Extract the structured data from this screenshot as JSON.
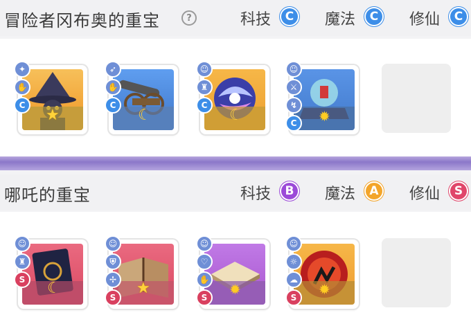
{
  "section1": {
    "title": "冒险者冈布奥的重宝",
    "help_icon": "?",
    "categories": [
      {
        "label": "科技",
        "grade": "C"
      },
      {
        "label": "魔法",
        "grade": "C"
      },
      {
        "label": "修仙",
        "grade": "C"
      }
    ],
    "items": [
      {
        "name": "witch-item",
        "theme": "#f2a63a",
        "bottom": "#b49a3c",
        "badge_grade": "C",
        "rating": "star"
      },
      {
        "name": "cannon-item",
        "theme": "#5c8fe0",
        "bottom": "#5b7db0",
        "badge_grade": "C",
        "rating": "moon"
      },
      {
        "name": "orb-item",
        "theme": "#f0a838",
        "bottom": "#c29a34",
        "badge_grade": "C",
        "rating": "moon"
      },
      {
        "name": "crystal-ball-item",
        "theme": "#4b84d6",
        "bottom": "#486d9e",
        "badge_grade": "C",
        "rating": "sun"
      }
    ]
  },
  "section2": {
    "title": "哪吒的重宝",
    "categories": [
      {
        "label": "科技",
        "grade": "B"
      },
      {
        "label": "魔法",
        "grade": "A"
      },
      {
        "label": "修仙",
        "grade": "S"
      }
    ],
    "items": [
      {
        "name": "dark-book-item",
        "theme": "#e0566e",
        "bottom": "#b24a66",
        "badge_grade": "S",
        "rating": "moon"
      },
      {
        "name": "old-book-item",
        "theme": "#e0566e",
        "bottom": "#c0566a",
        "badge_grade": "S",
        "rating": "star"
      },
      {
        "name": "scroll-item",
        "theme": "#b264d8",
        "bottom": "#8a5aa8",
        "badge_grade": "S",
        "rating": "sun"
      },
      {
        "name": "fire-orb-item",
        "theme": "#f2a63a",
        "bottom": "#b48a34",
        "badge_grade": "S",
        "rating": "sun"
      }
    ]
  }
}
